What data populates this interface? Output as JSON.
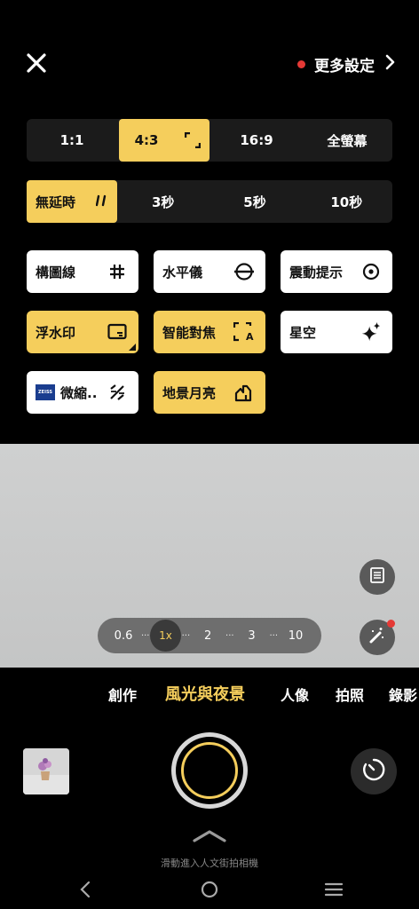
{
  "top": {
    "more_settings_label": "更多設定"
  },
  "aspect_ratio": {
    "options": [
      "1:1",
      "4:3",
      "16:9",
      "全螢幕"
    ],
    "selected": "4:3"
  },
  "timer": {
    "options": [
      "無延時",
      "3秒",
      "5秒",
      "10秒"
    ],
    "selected": "無延時"
  },
  "toggles": {
    "grid": {
      "label": "構圖線",
      "on": false
    },
    "level": {
      "label": "水平儀",
      "on": false
    },
    "shake_hint": {
      "label": "震動提示",
      "on": false
    },
    "watermark": {
      "label": "浮水印",
      "on": true
    },
    "smart_focus": {
      "label": "智能對焦",
      "on": true
    },
    "starry_sky": {
      "label": "星空",
      "on": false
    },
    "zeiss": {
      "label": "微縮..",
      "brand": "ZEISS",
      "on": false
    },
    "landscape_moon": {
      "label": "地景月亮",
      "on": true
    }
  },
  "zoom": {
    "levels": [
      "0.6",
      "1x",
      "2",
      "3",
      "10"
    ],
    "selected": "1x"
  },
  "modes": {
    "items": [
      "創作",
      "風光與夜景",
      "人像",
      "拍照",
      "錄影"
    ],
    "selected": "風光與夜景"
  },
  "hints": {
    "swipe_up": "滑動進入人文街拍相機"
  },
  "colors": {
    "accent": "#f5ce5c",
    "notification": "#e53935"
  }
}
